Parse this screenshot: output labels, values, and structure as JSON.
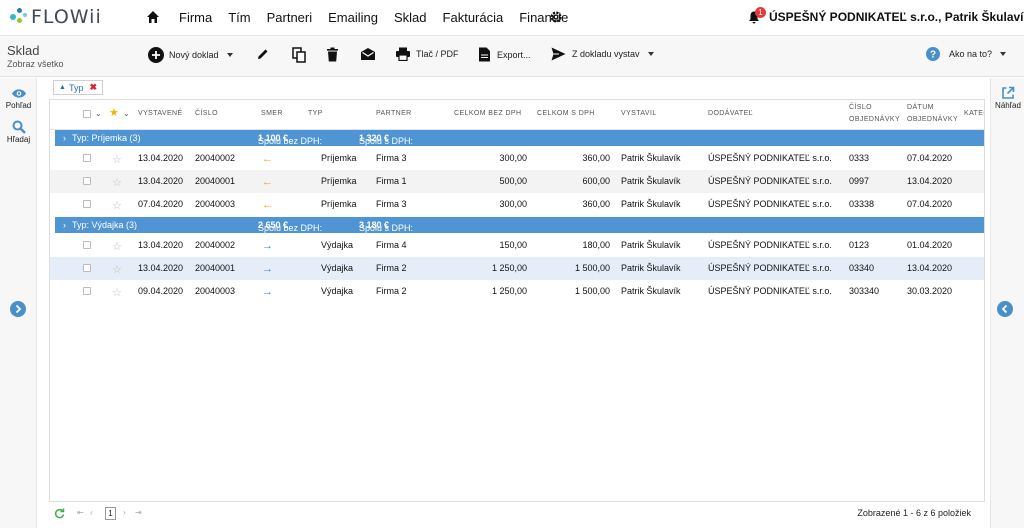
{
  "app": {
    "brand": "FLOWii",
    "company_user": "ÚSPEŠNÝ PODNIKATEĽ s.r.o., Patrik Škulavík",
    "notifications": "1"
  },
  "nav": {
    "items": [
      "Firma",
      "Tím",
      "Partneri",
      "Emailing",
      "Sklad",
      "Fakturácia",
      "Financie"
    ]
  },
  "page": {
    "title": "Sklad",
    "subtitle": "Zobraz všetko"
  },
  "toolbar": {
    "new_doc": "Nový doklad",
    "print": "Tlač / PDF",
    "export": "Export...",
    "issue_from": "Z dokladu vystav",
    "help": "Ako na to?"
  },
  "sidebar": {
    "view": "Pohľad",
    "search": "Hľadaj",
    "preview": "Náhľad"
  },
  "filter": {
    "label": "Typ"
  },
  "columns": {
    "issued": "VYSTAVENÉ",
    "number": "ČÍSLO",
    "direction": "SMER",
    "type": "TYP",
    "partner": "PARTNER",
    "total_no_vat": "CELKOM BEZ DPH",
    "total_vat": "CELKOM S DPH",
    "issued_by": "VYSTAVIL",
    "supplier": "DODÁVATEĽ",
    "order_no_1": "ČÍSLO",
    "order_no_2": "OBJEDNÁVKY",
    "order_date_1": "DÁTUM",
    "order_date_2": "OBJEDNÁVKY",
    "category": "KATEG"
  },
  "groups": [
    {
      "label": "Typ: Príjemka (3)",
      "sum_no_vat_label": "Spolu bez DPH:",
      "sum_no_vat": "1 100 €",
      "sum_vat_label": "Spolu s DPH:",
      "sum_vat": "1 320 €",
      "rows": [
        {
          "issued": "13.04.2020",
          "number": "20040002",
          "type": "Príjemka",
          "partner": "Firma 3",
          "total_no_vat": "300,00",
          "total_vat": "360,00",
          "issued_by": "Patrik Škulavík",
          "supplier": "ÚSPEŠNÝ PODNIKATEĽ s.r.o.",
          "order_no": "0333",
          "order_date": "07.04.2020"
        },
        {
          "issued": "13.04.2020",
          "number": "20040001",
          "type": "Príjemka",
          "partner": "Firma 1",
          "total_no_vat": "500,00",
          "total_vat": "600,00",
          "issued_by": "Patrik Škulavík",
          "supplier": "ÚSPEŠNÝ PODNIKATEĽ s.r.o.",
          "order_no": "0997",
          "order_date": "13.04.2020"
        },
        {
          "issued": "07.04.2020",
          "number": "20040003",
          "type": "Príjemka",
          "partner": "Firma 3",
          "total_no_vat": "300,00",
          "total_vat": "360,00",
          "issued_by": "Patrik Škulavík",
          "supplier": "ÚSPEŠNÝ PODNIKATEĽ s.r.o.",
          "order_no": "03338",
          "order_date": "07.04.2020"
        }
      ]
    },
    {
      "label": "Typ: Výdajka (3)",
      "sum_no_vat_label": "Spolu bez DPH:",
      "sum_no_vat": "2 650 €",
      "sum_vat_label": "Spolu s DPH:",
      "sum_vat": "3 180 €",
      "rows": [
        {
          "issued": "13.04.2020",
          "number": "20040002",
          "type": "Výdajka",
          "partner": "Firma 4",
          "total_no_vat": "150,00",
          "total_vat": "180,00",
          "issued_by": "Patrik Škulavík",
          "supplier": "ÚSPEŠNÝ PODNIKATEĽ s.r.o.",
          "order_no": "0123",
          "order_date": "01.04.2020"
        },
        {
          "issued": "13.04.2020",
          "number": "20040001",
          "type": "Výdajka",
          "partner": "Firma 2",
          "total_no_vat": "1 250,00",
          "total_vat": "1 500,00",
          "issued_by": "Patrik Škulavík",
          "supplier": "ÚSPEŠNÝ PODNIKATEĽ s.r.o.",
          "order_no": "03340",
          "order_date": "13.04.2020"
        },
        {
          "issued": "09.04.2020",
          "number": "20040003",
          "type": "Výdajka",
          "partner": "Firma 2",
          "total_no_vat": "1 250,00",
          "total_vat": "1 500,00",
          "issued_by": "Patrik Škulavík",
          "supplier": "ÚSPEŠNÝ PODNIKATEĽ s.r.o.",
          "order_no": "303340",
          "order_date": "30.03.2020"
        }
      ]
    }
  ],
  "footer": {
    "page": "1",
    "status": "Zobrazené 1 - 6 z 6 položiek"
  },
  "colors": {
    "accent": "#4f95d3",
    "in_arrow": "#e7a21c",
    "out_arrow": "#3a86d0",
    "star_header": "#f0b400",
    "badge": "#e23b3b"
  }
}
